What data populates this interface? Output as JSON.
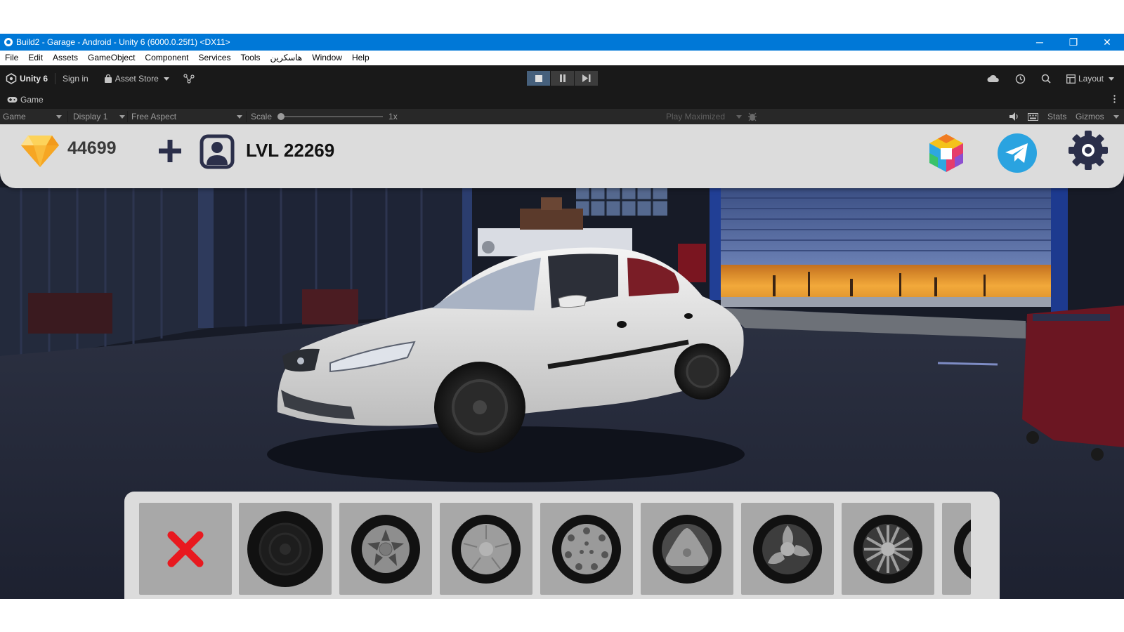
{
  "window": {
    "title": "Build2 - Garage - Android - Unity 6 (6000.0.25f1) <DX11>",
    "minimize_glyph": "─",
    "restore_glyph": "❐",
    "close_glyph": "✕"
  },
  "menu": [
    "File",
    "Edit",
    "Assets",
    "GameObject",
    "Component",
    "Services",
    "Tools",
    "هاسکرین",
    "Window",
    "Help"
  ],
  "toolbar": {
    "brand": "Unity 6",
    "sign_in": "Sign in",
    "asset_store": "Asset Store",
    "layout": "Layout"
  },
  "tab": {
    "label": "Game"
  },
  "game_bar": {
    "mode": "Game",
    "display": "Display 1",
    "aspect": "Free Aspect",
    "scale_label": "Scale",
    "scale_value": "1x",
    "play_mode": "Play Maximized",
    "stats": "Stats",
    "gizmos": "Gizmos"
  },
  "hud": {
    "coins": "44699",
    "level": "LVL 22269"
  },
  "colors": {
    "title_bar": "#0078d7",
    "hud_bg": "#dcdcdc",
    "slot_bg": "#a8a8a8",
    "remove_x": "#e8191f",
    "telegram": "#2aa3e0",
    "gear": "#2b2f4a"
  },
  "wheel_slots": [
    {
      "icon": "remove-icon"
    },
    {
      "icon": "wheel-plain-icon"
    },
    {
      "icon": "wheel-five-spoke-icon"
    },
    {
      "icon": "wheel-hubcap-icon"
    },
    {
      "icon": "wheel-holes-icon"
    },
    {
      "icon": "wheel-triangle-icon"
    },
    {
      "icon": "wheel-curved-spoke-icon"
    },
    {
      "icon": "wheel-multi-spoke-icon"
    },
    {
      "icon": "wheel-partial-icon"
    }
  ]
}
